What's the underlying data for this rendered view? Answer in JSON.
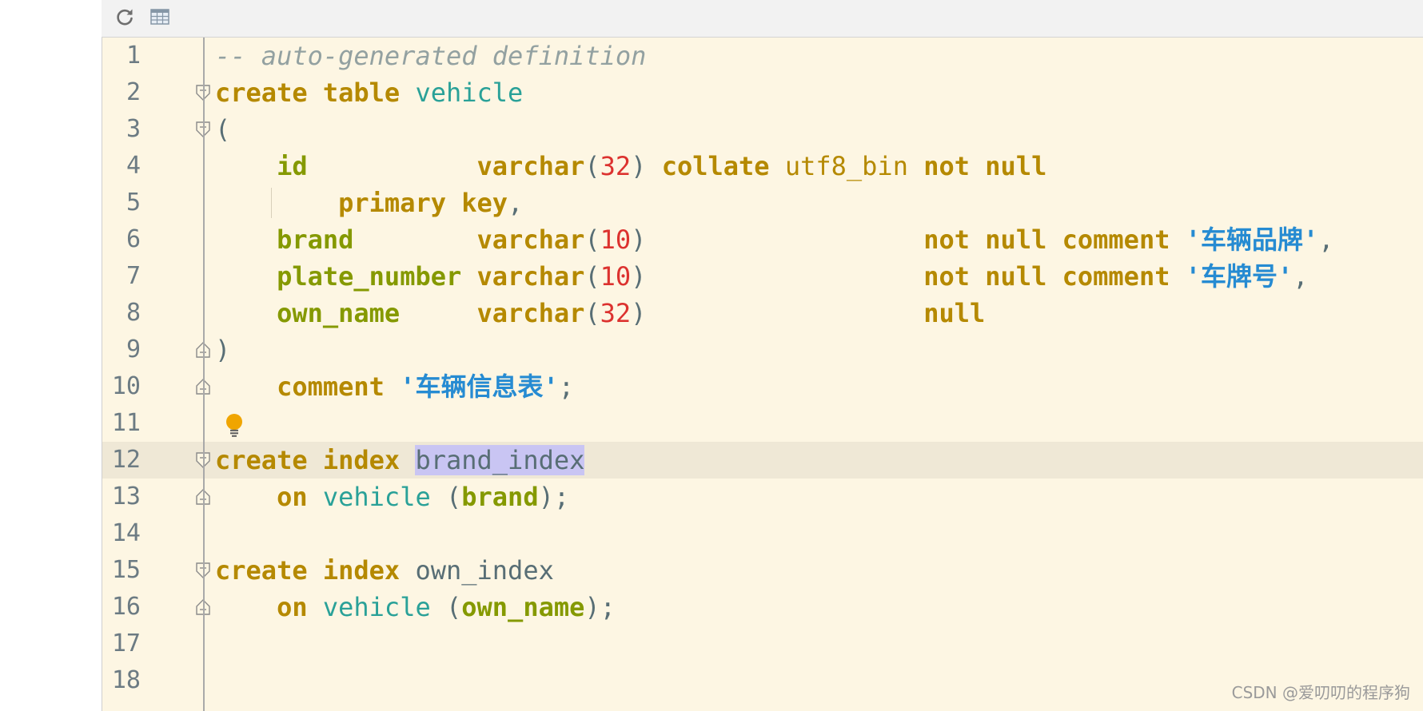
{
  "toolbar": {
    "buttons": [
      {
        "icon": "refresh-icon"
      },
      {
        "icon": "table-icon"
      }
    ]
  },
  "editor": {
    "lines": [
      {
        "n": "1",
        "tokens": [
          {
            "t": "-- auto-generated definition",
            "c": "cmt"
          }
        ]
      },
      {
        "n": "2",
        "tokens": [
          {
            "t": "create",
            "c": "kw"
          },
          {
            "t": " "
          },
          {
            "t": "table",
            "c": "kw"
          },
          {
            "t": " "
          },
          {
            "t": "vehicle",
            "c": "ident"
          }
        ]
      },
      {
        "n": "3",
        "tokens": [
          {
            "t": "("
          }
        ]
      },
      {
        "n": "4",
        "tokens": [
          {
            "t": "    "
          },
          {
            "t": "id",
            "c": "col"
          },
          {
            "t": "           "
          },
          {
            "t": "varchar",
            "c": "kw"
          },
          {
            "t": "("
          },
          {
            "t": "32",
            "c": "num"
          },
          {
            "t": ") "
          },
          {
            "t": "collate",
            "c": "kw"
          },
          {
            "t": " "
          },
          {
            "t": "utf8_bin",
            "c": "kw-plain"
          },
          {
            "t": " "
          },
          {
            "t": "not",
            "c": "kw"
          },
          {
            "t": " "
          },
          {
            "t": "null",
            "c": "kw"
          }
        ]
      },
      {
        "n": "5",
        "tokens": [
          {
            "t": "        "
          },
          {
            "t": "primary",
            "c": "kw"
          },
          {
            "t": " "
          },
          {
            "t": "key",
            "c": "kw"
          },
          {
            "t": ","
          }
        ]
      },
      {
        "n": "6",
        "tokens": [
          {
            "t": "    "
          },
          {
            "t": "brand",
            "c": "col"
          },
          {
            "t": "        "
          },
          {
            "t": "varchar",
            "c": "kw"
          },
          {
            "t": "("
          },
          {
            "t": "10",
            "c": "num"
          },
          {
            "t": ")                  "
          },
          {
            "t": "not",
            "c": "kw"
          },
          {
            "t": " "
          },
          {
            "t": "null",
            "c": "kw"
          },
          {
            "t": " "
          },
          {
            "t": "comment",
            "c": "kw"
          },
          {
            "t": " "
          },
          {
            "t": "'车辆品牌'",
            "c": "str"
          },
          {
            "t": ","
          }
        ]
      },
      {
        "n": "7",
        "tokens": [
          {
            "t": "    "
          },
          {
            "t": "plate_number",
            "c": "col"
          },
          {
            "t": " "
          },
          {
            "t": "varchar",
            "c": "kw"
          },
          {
            "t": "("
          },
          {
            "t": "10",
            "c": "num"
          },
          {
            "t": ")                  "
          },
          {
            "t": "not",
            "c": "kw"
          },
          {
            "t": " "
          },
          {
            "t": "null",
            "c": "kw"
          },
          {
            "t": " "
          },
          {
            "t": "comment",
            "c": "kw"
          },
          {
            "t": " "
          },
          {
            "t": "'车牌号'",
            "c": "str"
          },
          {
            "t": ","
          }
        ]
      },
      {
        "n": "8",
        "tokens": [
          {
            "t": "    "
          },
          {
            "t": "own_name",
            "c": "col"
          },
          {
            "t": "     "
          },
          {
            "t": "varchar",
            "c": "kw"
          },
          {
            "t": "("
          },
          {
            "t": "32",
            "c": "num"
          },
          {
            "t": ")                  "
          },
          {
            "t": "null",
            "c": "kw"
          }
        ]
      },
      {
        "n": "9",
        "tokens": [
          {
            "t": ")"
          }
        ]
      },
      {
        "n": "10",
        "tokens": [
          {
            "t": "    "
          },
          {
            "t": "comment",
            "c": "kw"
          },
          {
            "t": " "
          },
          {
            "t": "'车辆信息表'",
            "c": "str"
          },
          {
            "t": ";"
          }
        ]
      },
      {
        "n": "11",
        "tokens": []
      },
      {
        "n": "12",
        "tokens": [
          {
            "t": "create",
            "c": "kw"
          },
          {
            "t": " "
          },
          {
            "t": "index",
            "c": "kw"
          },
          {
            "t": " "
          },
          {
            "t": "brand_index",
            "c": "sel"
          }
        ]
      },
      {
        "n": "13",
        "tokens": [
          {
            "t": "    "
          },
          {
            "t": "on",
            "c": "kw"
          },
          {
            "t": " "
          },
          {
            "t": "vehicle",
            "c": "ident"
          },
          {
            "t": " ("
          },
          {
            "t": "brand",
            "c": "col"
          },
          {
            "t": ");"
          }
        ]
      },
      {
        "n": "14",
        "tokens": []
      },
      {
        "n": "15",
        "tokens": [
          {
            "t": "create",
            "c": "kw"
          },
          {
            "t": " "
          },
          {
            "t": "index",
            "c": "kw"
          },
          {
            "t": " "
          },
          {
            "t": "own_index"
          }
        ]
      },
      {
        "n": "16",
        "tokens": [
          {
            "t": "    "
          },
          {
            "t": "on",
            "c": "kw"
          },
          {
            "t": " "
          },
          {
            "t": "vehicle",
            "c": "ident"
          },
          {
            "t": " ("
          },
          {
            "t": "own_name",
            "c": "col"
          },
          {
            "t": ");"
          }
        ]
      },
      {
        "n": "17",
        "tokens": []
      },
      {
        "n": "18",
        "tokens": []
      }
    ],
    "current_line": "12",
    "intention_icon": "lightbulb-icon"
  },
  "watermark": "CSDN @爱叨叨的程序狗",
  "colors": {
    "editor_bg": "#fdf6e3",
    "keyword": "#b58900",
    "column": "#859900",
    "identifier": "#2aa198",
    "number": "#dc322f",
    "string": "#268bd2",
    "comment": "#93a1a1",
    "selection": "#c9c5f3"
  }
}
